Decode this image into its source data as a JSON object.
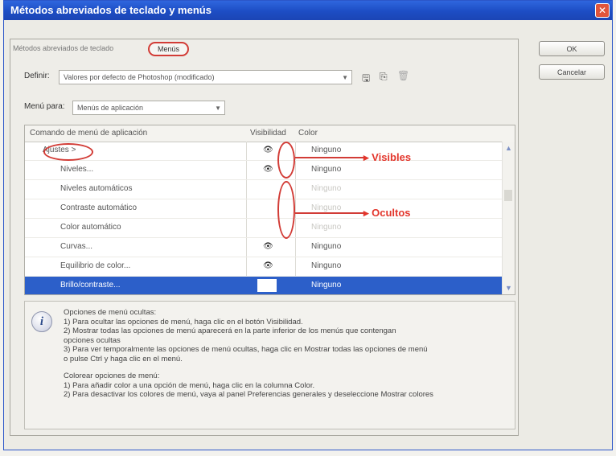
{
  "window": {
    "title": "Métodos abreviados de teclado y menús",
    "close_glyph": "✕"
  },
  "tabs": [
    "Métodos abreviados de teclado",
    "Menús"
  ],
  "buttons": {
    "ok": "OK",
    "cancel": "Cancelar"
  },
  "definir": {
    "label": "Definir:",
    "value": "Valores por defecto de Photoshop (modificado)"
  },
  "menu_para": {
    "label": "Menú para:",
    "value": "Menús de aplicación"
  },
  "table": {
    "headers": [
      "Comando de menú de aplicación",
      "Visibilidad",
      "Color"
    ],
    "rows": [
      {
        "command": "Ajustes >",
        "visible": true,
        "color": "Ninguno",
        "indent": 0
      },
      {
        "command": "Niveles...",
        "visible": true,
        "color": "Ninguno",
        "indent": 1
      },
      {
        "command": "Niveles automáticos",
        "visible": false,
        "color": "Ninguno",
        "indent": 1
      },
      {
        "command": "Contraste automático",
        "visible": false,
        "color": "Ninguno",
        "indent": 1
      },
      {
        "command": "Color automático",
        "visible": false,
        "color": "Ninguno",
        "indent": 1
      },
      {
        "command": "Curvas...",
        "visible": true,
        "color": "Ninguno",
        "indent": 1
      },
      {
        "command": "Equilibrio de color...",
        "visible": true,
        "color": "Ninguno",
        "indent": 1
      },
      {
        "command": "Brillo/contraste...",
        "visible": true,
        "color": "Ninguno",
        "indent": 1,
        "selected": true
      }
    ]
  },
  "annotations": {
    "visibles": "Visibles",
    "ocultos": "Ocultos"
  },
  "info": {
    "lines_1": [
      "Opciones de menú ocultas:",
      "1) Para ocultar las opciones de menú, haga clic en el botón Visibilidad.",
      "2) Mostrar todas las opciones de menú aparecerá en la parte inferior de los menús que contengan",
      "opciones ocultas",
      "3) Para ver temporalmente las opciones de menú ocultas, haga clic en Mostrar todas las opciones de menú",
      "o pulse Ctrl y haga clic en el menú."
    ],
    "lines_2": [
      "Colorear opciones de menú:",
      "1) Para añadir color a una opción de menú, haga clic en la columna Color.",
      "2) Para desactivar los colores de menú, vaya al panel Preferencias generales y deseleccione Mostrar colores"
    ]
  },
  "colors": {
    "title_bar": "#1d4dc4",
    "selection": "#2c5fc9",
    "annotation": "#e3362c"
  }
}
